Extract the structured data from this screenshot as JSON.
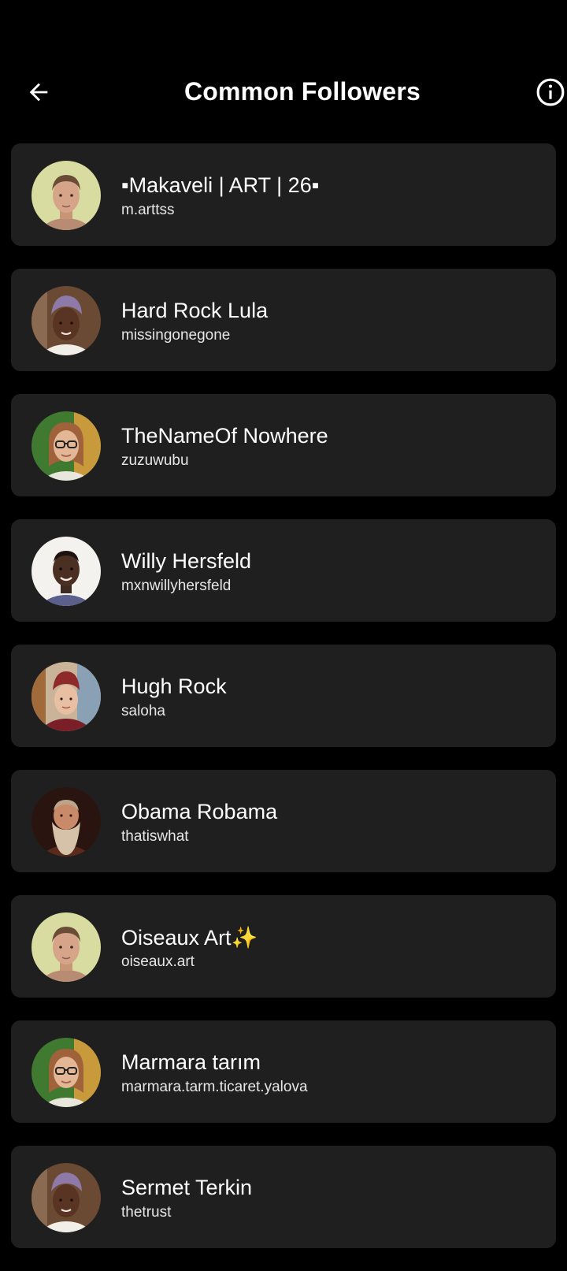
{
  "header": {
    "title": "Common Followers",
    "back_icon": "arrow-left-icon",
    "info_icon": "info-circle-icon"
  },
  "followers": [
    {
      "name": "▪Makaveli | ART | 26▪",
      "username": "m.arttss"
    },
    {
      "name": "Hard Rock Lula",
      "username": "missingonegone"
    },
    {
      "name": "TheNameOf Nowhere",
      "username": "zuzuwubu"
    },
    {
      "name": "Willy Hersfeld",
      "username": "mxnwillyhersfeld"
    },
    {
      "name": "Hugh Rock",
      "username": "saloha"
    },
    {
      "name": "Obama Robama",
      "username": "thatiswhat"
    },
    {
      "name": "Oiseaux Art✨",
      "username": "oiseaux.art"
    },
    {
      "name": "Marmara tarım",
      "username": "marmara.tarm.ticaret.yalova"
    },
    {
      "name": "Sermet Terkin",
      "username": "thetrust"
    }
  ],
  "colors": {
    "background": "#000000",
    "card": "#1f1f1f",
    "text_primary": "#ffffff",
    "text_secondary": "#e6e6e6"
  }
}
